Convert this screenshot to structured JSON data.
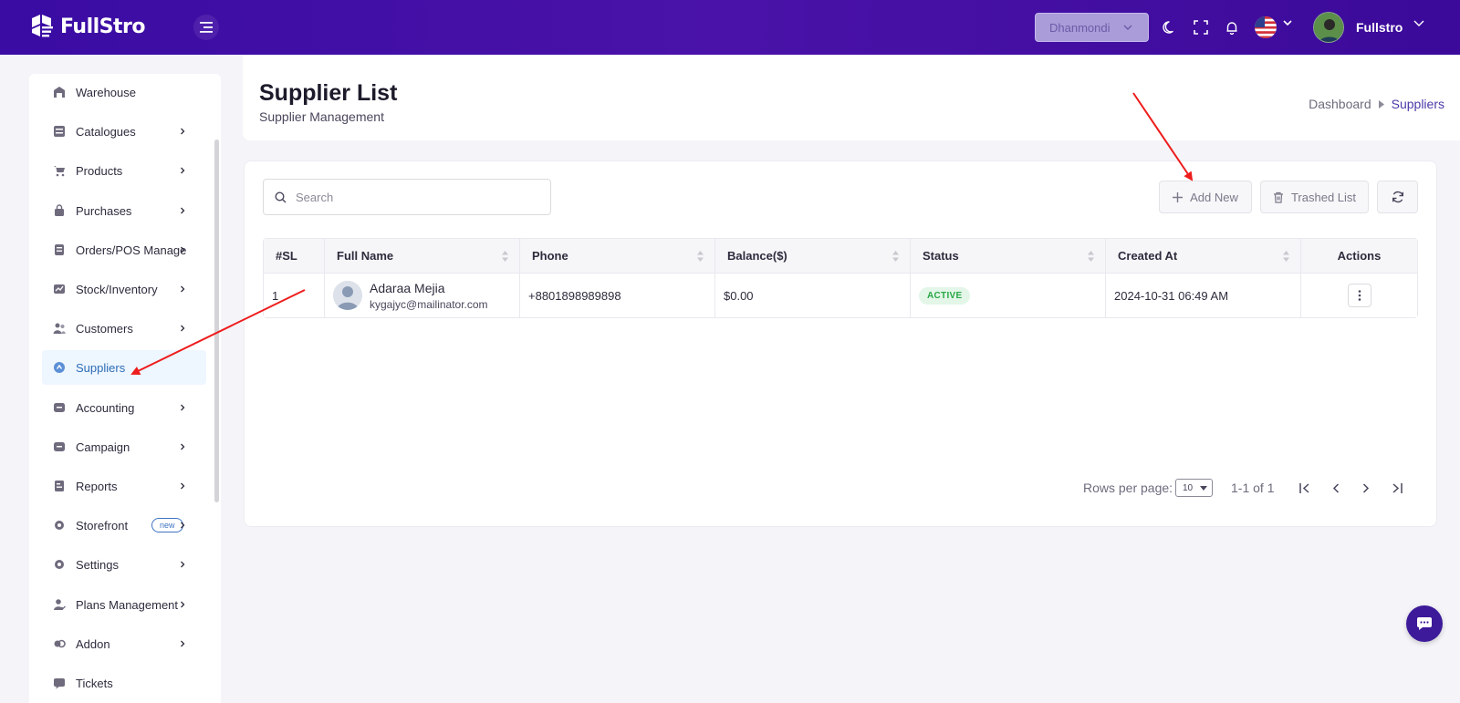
{
  "app": {
    "logo_text": "FullStro"
  },
  "topbar": {
    "branch": "Dhanmondi",
    "user_name": "Fullstro"
  },
  "sidebar": {
    "items": [
      {
        "label": "Warehouse",
        "icon": "warehouse-icon",
        "has_children": false
      },
      {
        "label": "Catalogues",
        "icon": "catalogue-icon",
        "has_children": true
      },
      {
        "label": "Products",
        "icon": "cart-icon",
        "has_children": true
      },
      {
        "label": "Purchases",
        "icon": "bag-icon",
        "has_children": true
      },
      {
        "label": "Orders/POS Manage",
        "icon": "orders-icon",
        "has_children": true
      },
      {
        "label": "Stock/Inventory",
        "icon": "stock-icon",
        "has_children": true
      },
      {
        "label": "Customers",
        "icon": "users-icon",
        "has_children": true
      },
      {
        "label": "Suppliers",
        "icon": "supplier-icon",
        "has_children": false,
        "active": true
      },
      {
        "label": "Accounting",
        "icon": "accounting-icon",
        "has_children": true
      },
      {
        "label": "Campaign",
        "icon": "campaign-icon",
        "has_children": true
      },
      {
        "label": "Reports",
        "icon": "reports-icon",
        "has_children": true
      },
      {
        "label": "Storefront",
        "icon": "storefront-icon",
        "has_children": true,
        "badge": "new"
      },
      {
        "label": "Settings",
        "icon": "settings-icon",
        "has_children": true
      },
      {
        "label": "Plans Management",
        "icon": "plans-icon",
        "has_children": true
      },
      {
        "label": "Addon",
        "icon": "addon-icon",
        "has_children": true
      },
      {
        "label": "Tickets",
        "icon": "tickets-icon",
        "has_children": false
      }
    ]
  },
  "header": {
    "title": "Supplier List",
    "subtitle": "Supplier Management",
    "breadcrumb": {
      "home": "Dashboard",
      "current": "Suppliers"
    }
  },
  "toolbar": {
    "search_placeholder": "Search",
    "add_new_label": "Add New",
    "trashed_label": "Trashed List"
  },
  "table": {
    "columns": [
      "#SL",
      "Full Name",
      "Phone",
      "Balance($)",
      "Status",
      "Created At",
      "Actions"
    ],
    "rows": [
      {
        "sl": "1",
        "name": "Adaraa Mejia",
        "email": "kygajyc@mailinator.com",
        "phone": "+8801898989898",
        "balance": "$0.00",
        "status": "ACTIVE",
        "created_at": "2024-10-31 06:49 AM"
      }
    ]
  },
  "pagination": {
    "rows_per_page_label": "Rows per page:",
    "rows_per_page": "10",
    "range": "1-1 of 1"
  },
  "colors": {
    "topbar": "#3a0ca3",
    "accent": "#4a3aa8",
    "active_status": "#28a745",
    "annotation_arrow": "#ee1c1c"
  }
}
